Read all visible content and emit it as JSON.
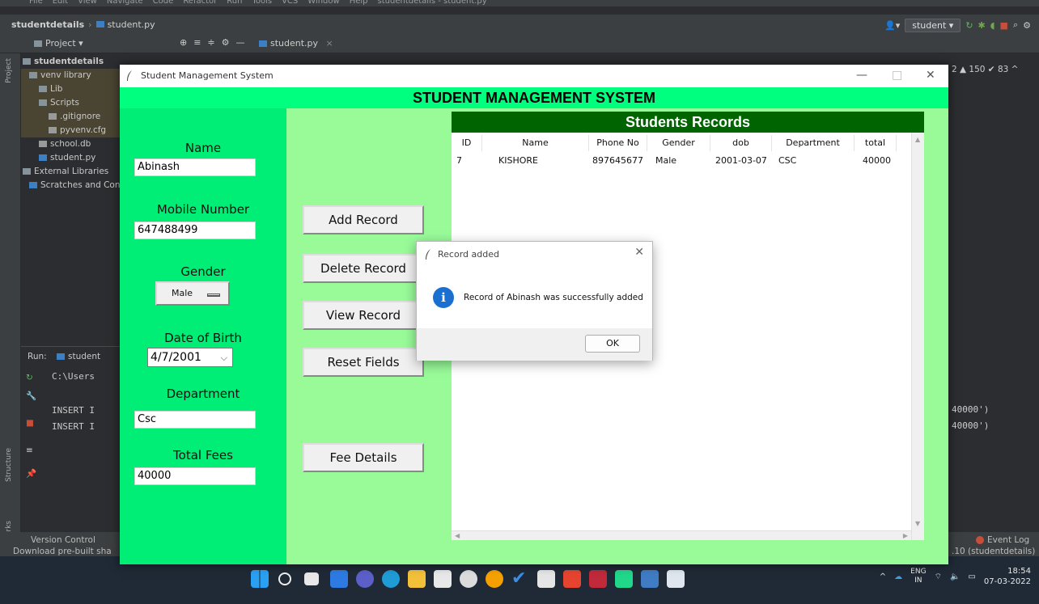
{
  "ide": {
    "menu": [
      "File",
      "Edit",
      "View",
      "Navigate",
      "Code",
      "Refactor",
      "Run",
      "Tools",
      "VCS",
      "Window",
      "Help",
      "studentdetails - student.py"
    ],
    "breadcrumb_project": "studentdetails",
    "breadcrumb_file": "student.py",
    "run_config": "student ▾",
    "project_label": "Project ▾",
    "editor_tab": "student.py",
    "tree": [
      {
        "label": "studentdetails",
        "indent": 0
      },
      {
        "label": "venv library",
        "indent": 1
      },
      {
        "label": "Lib",
        "indent": 2
      },
      {
        "label": "Scripts",
        "indent": 2
      },
      {
        "label": ".gitignore",
        "indent": 3
      },
      {
        "label": "pyvenv.cfg",
        "indent": 3
      },
      {
        "label": "school.db",
        "indent": 2
      },
      {
        "label": "student.py",
        "indent": 2
      },
      {
        "label": "External Libraries",
        "indent": 0
      },
      {
        "label": "Scratches and Consoles",
        "indent": 1
      }
    ],
    "run_label": "Run:",
    "run_tab": "student",
    "console": [
      "C:\\Users",
      "INSERT I",
      "INSERT I"
    ],
    "console_right": [
      "40000')",
      "40000')"
    ],
    "inspections": "2 ▲ 150 ✔ 83 ^",
    "version_control": "Version Control",
    "status_msg": "Download pre-built sha",
    "event_log": "Event Log",
    "interpreter": ".10 (studentdetails)",
    "strip_labels": [
      "Project",
      "Structure",
      "Bookmarks"
    ]
  },
  "taskbar": {
    "lang_top": "ENG",
    "lang_bottom": "IN",
    "time": "18:54",
    "date": "07-03-2022"
  },
  "app": {
    "window_title": "Student Management System",
    "header": "STUDENT MANAGEMENT SYSTEM",
    "form": {
      "name_label": "Name",
      "name_value": "Abinash",
      "mobile_label": "Mobile Number",
      "mobile_value": "647488499",
      "gender_label": "Gender",
      "gender_value": "Male",
      "dob_label": "Date of Birth",
      "dob_value": "4/7/2001",
      "department_label": "Department",
      "department_value": "Csc",
      "fees_label": "Total Fees",
      "fees_value": "40000"
    },
    "buttons": {
      "add": "Add Record",
      "delete": "Delete Record",
      "view": "View Record",
      "reset": "Reset Fields",
      "fees": "Fee Details"
    },
    "records": {
      "title": "Students Records",
      "columns": [
        "ID",
        "Name",
        "Phone No",
        "Gender",
        "dob",
        "Department",
        "total"
      ],
      "rows": [
        [
          "7",
          "KISHORE",
          "897645677",
          "Male",
          "2001-03-07",
          "CSC",
          "40000"
        ]
      ]
    }
  },
  "dialog": {
    "title": "Record added",
    "message": "Record of Abinash was successfully added",
    "ok": "OK"
  }
}
